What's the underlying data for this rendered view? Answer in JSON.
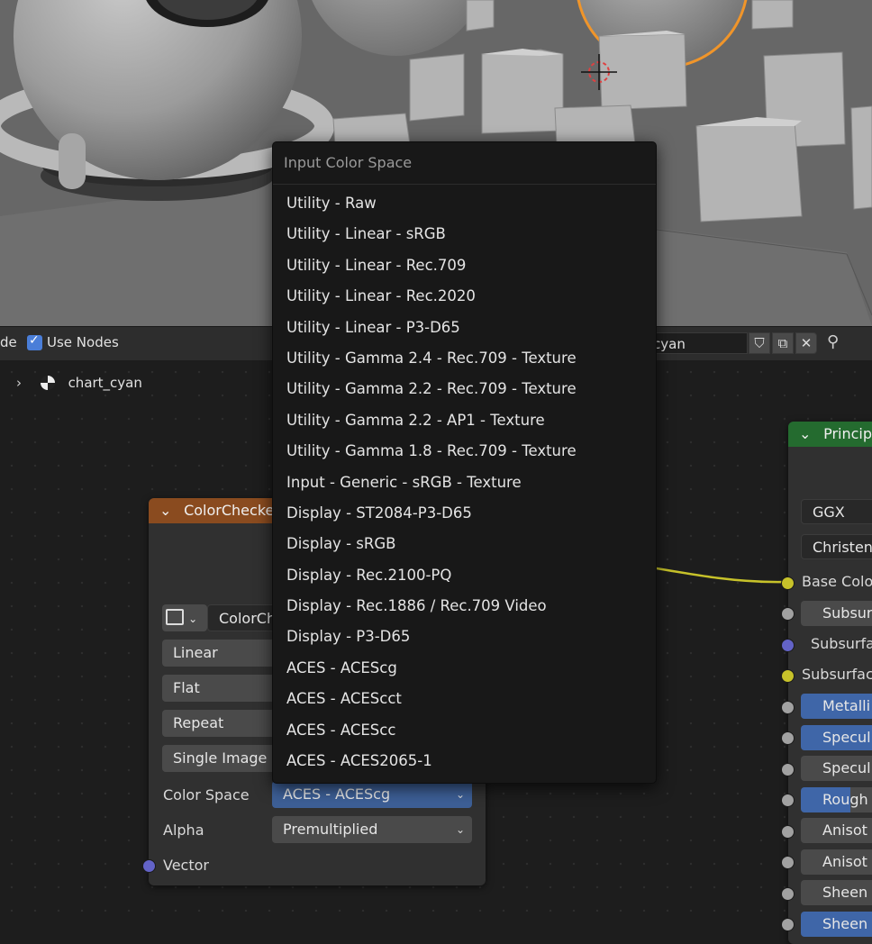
{
  "viewport": {},
  "header": {
    "left_fragment": "de",
    "use_nodes_label": "Use Nodes",
    "material_name": "cyan",
    "icons": [
      "shield-icon",
      "duplicate-icon",
      "close-icon",
      "pin-icon"
    ]
  },
  "breadcrumb": {
    "label": "chart_cyan"
  },
  "texture_node": {
    "title": "ColorChecke",
    "image_name": "ColorCh",
    "interpolation": "Linear",
    "projection": "Flat",
    "extension": "Repeat",
    "source": "Single Image",
    "color_space_label": "Color Space",
    "color_space_value": "ACES - ACEScg",
    "alpha_label": "Alpha",
    "alpha_value": "Premultiplied",
    "vector_label": "Vector"
  },
  "bsdf_node": {
    "title": "Princip",
    "distribution": "GGX",
    "subsurface_method": "Christen",
    "inputs": [
      "Base Colo",
      "Subsur",
      "Subsurfa",
      "Subsurfac",
      "Metalli",
      "Specul",
      "Specul",
      "Rough",
      "Anisot",
      "Anisot",
      "Sheen",
      "Sheen"
    ]
  },
  "dropdown": {
    "title": "Input Color Space",
    "items": [
      "Utility - Raw",
      "Utility - Linear - sRGB",
      "Utility - Linear - Rec.709",
      "Utility - Linear - Rec.2020",
      "Utility - Linear - P3-D65",
      "Utility - Gamma 2.4 - Rec.709 - Texture",
      "Utility - Gamma 2.2 - Rec.709 - Texture",
      "Utility - Gamma 2.2 - AP1 - Texture",
      "Utility - Gamma 1.8 - Rec.709 - Texture",
      "Input - Generic - sRGB - Texture",
      "Display - ST2084-P3-D65",
      "Display - sRGB",
      "Display - Rec.2100-PQ",
      "Display - Rec.1886 / Rec.709 Video",
      "Display - P3-D65",
      "ACES - ACEScg",
      "ACES - ACEScct",
      "ACES - ACEScc",
      "ACES - ACES2065-1"
    ]
  },
  "colors": {
    "accent_blue": "#4a7ed8",
    "selection_orange": "#f0952a",
    "texture_node_header": "#8a4b1f",
    "bsdf_node_header": "#246b2f",
    "socket_yellow": "#c7c22a",
    "socket_grey": "#a1a1a1",
    "socket_purple": "#6363c7"
  }
}
